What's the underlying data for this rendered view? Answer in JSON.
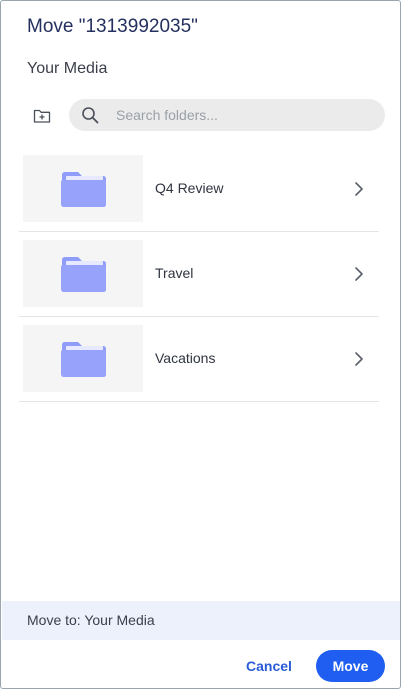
{
  "dialog": {
    "title": "Move \"1313992035\"",
    "section_label": "Your Media"
  },
  "search": {
    "placeholder": "Search folders...",
    "value": ""
  },
  "icons": {
    "new_folder": "new-folder-icon",
    "search": "search-icon",
    "folder": "folder-icon",
    "chevron": "chevron-right-icon"
  },
  "folders": [
    {
      "name": "Q4 Review"
    },
    {
      "name": "Travel"
    },
    {
      "name": "Vacations"
    }
  ],
  "footer": {
    "destination": "Move to: Your Media",
    "cancel_label": "Cancel",
    "move_label": "Move"
  },
  "colors": {
    "accent": "#1f5ef0",
    "folder": "#8f9cfa",
    "footer_bg": "#edf1fb"
  }
}
